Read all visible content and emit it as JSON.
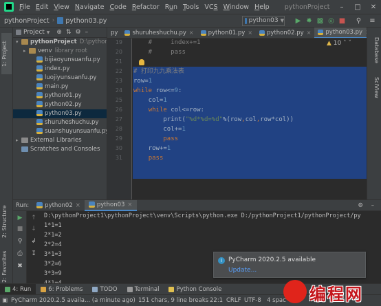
{
  "menubar": {
    "items": [
      "File",
      "Edit",
      "View",
      "Navigate",
      "Code",
      "Refactor",
      "Run",
      "Tools",
      "VCS",
      "Window",
      "Help"
    ],
    "mnemonics": [
      "F",
      "E",
      "V",
      "N",
      "C",
      "R",
      "u",
      "T",
      "S",
      "W",
      "H"
    ],
    "window_title": "pythonProject"
  },
  "navbar": {
    "project": "pythonProject",
    "file": "python03.py",
    "run_config": "python03"
  },
  "project_panel": {
    "title": "Project",
    "tree": [
      {
        "label": "pythonProject",
        "suffix": "D:\\pythonPr",
        "kind": "folder",
        "indent": 0,
        "arrow": "down",
        "bold": true
      },
      {
        "label": "venv",
        "suffix": "library root",
        "kind": "folder",
        "indent": 1,
        "arrow": "right"
      },
      {
        "label": "bijiaoyunsuanfu.py",
        "kind": "py",
        "indent": 2
      },
      {
        "label": "index.py",
        "kind": "py",
        "indent": 2
      },
      {
        "label": "luojiyunsuanfu.py",
        "kind": "py",
        "indent": 2
      },
      {
        "label": "main.py",
        "kind": "py",
        "indent": 2
      },
      {
        "label": "python01.py",
        "kind": "py",
        "indent": 2
      },
      {
        "label": "python02.py",
        "kind": "py",
        "indent": 2
      },
      {
        "label": "python03.py",
        "kind": "py",
        "indent": 2,
        "selected": true
      },
      {
        "label": "shuruheshuchu.py",
        "kind": "py",
        "indent": 2
      },
      {
        "label": "suanshuyunsuanfu.py",
        "kind": "py",
        "indent": 2
      },
      {
        "label": "External Libraries",
        "kind": "lib",
        "indent": 0,
        "arrow": "right"
      },
      {
        "label": "Scratches and Consoles",
        "kind": "scratch",
        "indent": 0
      }
    ]
  },
  "editor_tabs": [
    "py",
    "shuruheshuchu.py",
    "python01.py",
    "python02.py",
    "python03.py"
  ],
  "active_tab_index": 4,
  "editor": {
    "inspection_count": "10",
    "line_numbers": [
      "19",
      "20",
      "21",
      "22",
      "23",
      "24",
      "25",
      "26",
      "27",
      "28",
      "29",
      "30",
      "31"
    ],
    "lines": [
      [
        {
          "t": "    #     index+=1",
          "c": "cmt"
        }
      ],
      [
        {
          "t": "    #     pass",
          "c": "cmt"
        }
      ],
      [
        {
          "t": "",
          "c": ""
        }
      ],
      [
        {
          "t": "# 打印九九乘法表",
          "c": "cmt"
        }
      ],
      [
        {
          "t": "row",
          "c": ""
        },
        {
          "t": "=",
          "c": ""
        },
        {
          "t": "1",
          "c": "num"
        }
      ],
      [
        {
          "t": "while ",
          "c": "kw"
        },
        {
          "t": "row<=",
          "c": ""
        },
        {
          "t": "9",
          "c": "num"
        },
        {
          "t": ":",
          "c": ""
        }
      ],
      [
        {
          "t": "    col=",
          "c": ""
        },
        {
          "t": "1",
          "c": "num"
        }
      ],
      [
        {
          "t": "    ",
          "c": ""
        },
        {
          "t": "while ",
          "c": "kw"
        },
        {
          "t": "col<=row:",
          "c": ""
        }
      ],
      [
        {
          "t": "        print(",
          "c": ""
        },
        {
          "t": "\"%d*%d=%d\"",
          "c": "str"
        },
        {
          "t": "%(row",
          "c": ""
        },
        {
          "t": ",",
          "c": "kw"
        },
        {
          "t": "col",
          "c": ""
        },
        {
          "t": ",",
          "c": "kw"
        },
        {
          "t": "row*col))",
          "c": ""
        }
      ],
      [
        {
          "t": "        col+=",
          "c": ""
        },
        {
          "t": "1",
          "c": "num"
        }
      ],
      [
        {
          "t": "        ",
          "c": ""
        },
        {
          "t": "pass",
          "c": "kw"
        }
      ],
      [
        {
          "t": "    row+=",
          "c": ""
        },
        {
          "t": "1",
          "c": "num"
        }
      ],
      [
        {
          "t": "    ",
          "c": ""
        },
        {
          "t": "pass",
          "c": "kw"
        }
      ]
    ]
  },
  "run_panel": {
    "label": "Run:",
    "tabs": [
      "python02",
      "python03"
    ],
    "command": "D:\\pythonProject1\\pythonProject\\venv\\Scripts\\python.exe D:/pythonProject1/pythonProject/py",
    "output": [
      "1*1=1",
      "2*1=2",
      "2*2=4",
      "3*1=3",
      "3*2=6",
      "3*3=9",
      "4*1=4"
    ]
  },
  "notification": {
    "title": "PyCharm 2020.2.5 available",
    "link": "Update..."
  },
  "tool_tabs": [
    "4: Run",
    "6: Problems",
    "TODO",
    "Terminal",
    "Python Console"
  ],
  "left_strip": {
    "project": "1: Project",
    "structure": "2: Structure",
    "favorites": "2: Favorites"
  },
  "right_strip": {
    "database": "Database",
    "sciview": "SciView"
  },
  "statusbar": {
    "message": "PyCharm 2020.2.5 availa... (a minute ago)",
    "chars": "151 chars, 9 line breaks",
    "position": "22:1",
    "line_sep": "CRLF",
    "encoding": "UTF-8",
    "indent": "4 spac"
  },
  "watermark": {
    "logo": "M",
    "text": "编程网"
  },
  "colors": {
    "selection": "#214283",
    "keyword": "#cc7832",
    "number": "#6897bb",
    "string": "#6a8759",
    "comment": "#808080",
    "accent": "#4a88c7"
  }
}
